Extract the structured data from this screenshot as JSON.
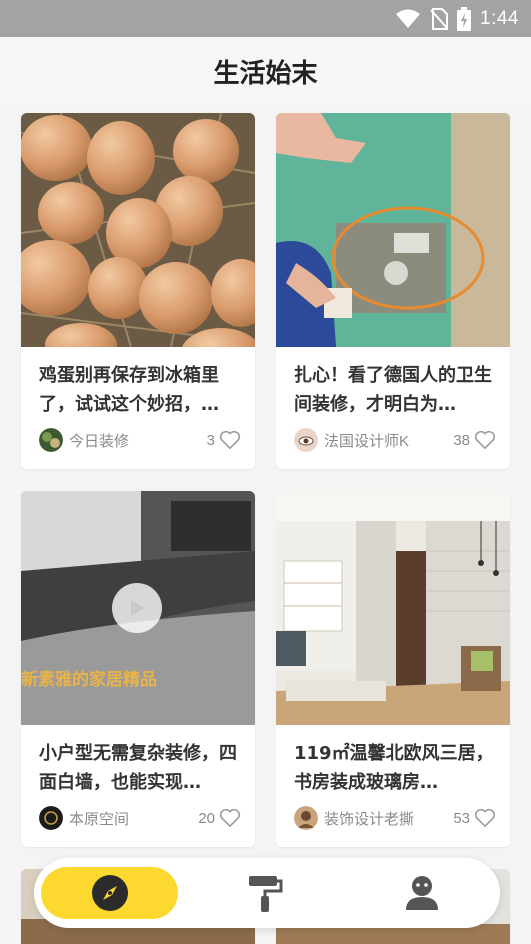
{
  "status_bar": {
    "time": "1:44",
    "icons": [
      "wifi-icon",
      "no-sim-icon",
      "battery-charging-icon"
    ]
  },
  "header": {
    "title": "生活始末"
  },
  "feed": {
    "cards": [
      {
        "title": "鸡蛋别再保存到冰箱里了，试试这个妙招，…",
        "author": "今日装修",
        "likes": "3",
        "image": "eggs-photo",
        "has_video": false
      },
      {
        "title": "扎心！看了德国人的卫生间装修，才明白为…",
        "author": "法国设计师K",
        "likes": "38",
        "image": "bathroom-wall-photo",
        "has_video": false
      },
      {
        "title": "小户型无需复杂装修，四面白墙，也能实现…",
        "author": "本原空间",
        "likes": "20",
        "image": "video-thumbnail",
        "has_video": true,
        "overlay_text": "新素雅的家居精品"
      },
      {
        "title": "119㎡温馨北欧风三居，书房装成玻璃房…",
        "author": "装饰设计老撕",
        "likes": "53",
        "image": "nordic-interior-photo",
        "has_video": false
      }
    ]
  },
  "bottom_nav": {
    "items": [
      {
        "name": "discover",
        "icon": "compass-icon",
        "active": true
      },
      {
        "name": "decorate",
        "icon": "paint-roller-icon",
        "active": false
      },
      {
        "name": "profile",
        "icon": "user-icon",
        "active": false
      }
    ]
  },
  "colors": {
    "accent": "#fdd92f",
    "status_bar": "#a3a3a3",
    "background": "#f4f4f4"
  }
}
